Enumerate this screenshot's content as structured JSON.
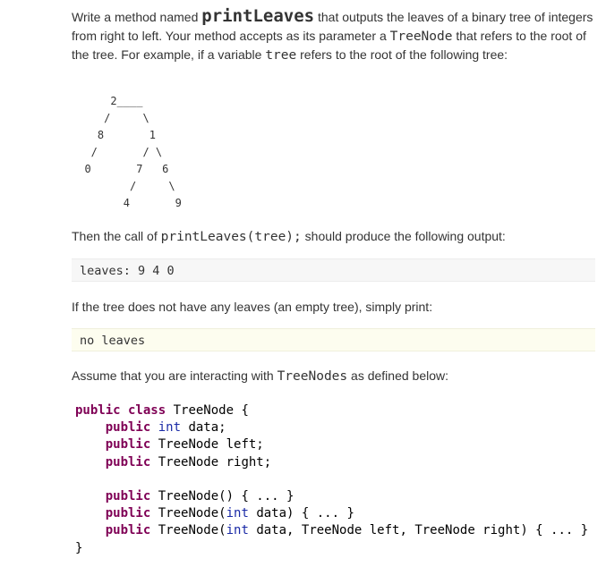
{
  "intro": {
    "p1_a": "Write a method named ",
    "method_name": "printLeaves",
    "p1_b": " that outputs the leaves of a binary tree of integers from right to left. Your method accepts as its parameter a ",
    "type_name": "TreeNode",
    "p1_c": " that refers to the root of the tree. For example, if a variable ",
    "var_name": "tree",
    "p1_d": " refers to the root of the following tree:"
  },
  "tree_diagram": "      2____\n     /     \\\n    8       1\n   /       / \\\n  0       7   6\n         /     \\\n        4       9",
  "then": {
    "a": "Then the call of ",
    "call": "printLeaves(tree);",
    "b": " should produce the following output:"
  },
  "output1": "leaves: 9 4 0",
  "empty_text": "If the tree does not have any leaves (an empty tree), simply print:",
  "output2": "no leaves",
  "assume": {
    "a": "Assume that you are interacting with ",
    "type": "TreeNodes",
    "b": " as defined below:"
  },
  "code": {
    "l1_kw": "public class",
    "l1_name": " TreeNode {",
    "field1_kw": "public",
    "field1_ty": " int",
    "field1_rest": " data;",
    "field2_kw": "public",
    "field2_rest": " TreeNode left;",
    "field3_kw": "public",
    "field3_rest": " TreeNode right;",
    "ctor1_kw": "public",
    "ctor1_rest": " TreeNode() { ... }",
    "ctor2_kw": "public",
    "ctor2_a": " TreeNode(",
    "ctor2_ty": "int",
    "ctor2_b": " data) { ... }",
    "ctor3_kw": "public",
    "ctor3_a": " TreeNode(",
    "ctor3_ty": "int",
    "ctor3_b": " data, TreeNode left, TreeNode right) { ... }",
    "close": "}"
  }
}
